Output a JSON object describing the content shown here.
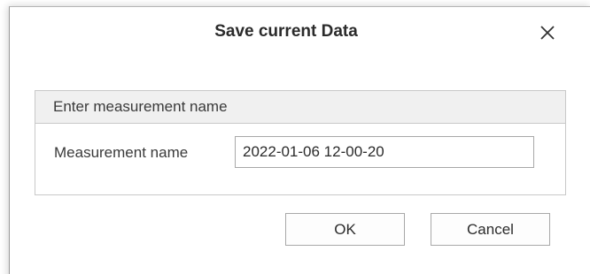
{
  "dialog": {
    "title": "Save current Data",
    "close_icon": "close-icon"
  },
  "group": {
    "header": "Enter measurement name",
    "field_label": "Measurement name",
    "field_value": "2022-01-06 12-00-20"
  },
  "buttons": {
    "ok_label": "OK",
    "cancel_label": "Cancel"
  },
  "colors": {
    "group_header_bg": "#f0f0f0",
    "border": "#c8c8c8",
    "text": "#2b2b2b"
  }
}
